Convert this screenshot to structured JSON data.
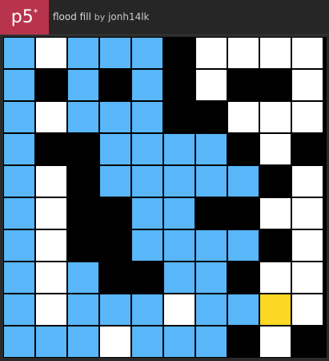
{
  "header": {
    "logo_text": "p5",
    "logo_mark": "*",
    "sketch_name": "flood fill",
    "by_label": "by",
    "author": "jonh14lk"
  },
  "palette": {
    "B": "#58b6f9",
    "W": "#ffffff",
    "K": "#000000",
    "Y": "#fcd723"
  },
  "board": {
    "rows": [
      [
        "B",
        "W",
        "B",
        "B",
        "B",
        "K",
        "W",
        "W",
        "W",
        "W"
      ],
      [
        "B",
        "K",
        "B",
        "K",
        "B",
        "K",
        "W",
        "K",
        "K",
        "W"
      ],
      [
        "B",
        "W",
        "B",
        "B",
        "B",
        "K",
        "K",
        "W",
        "W",
        "W"
      ],
      [
        "B",
        "K",
        "K",
        "B",
        "B",
        "B",
        "B",
        "K",
        "W",
        "K"
      ],
      [
        "B",
        "W",
        "K",
        "B",
        "B",
        "B",
        "B",
        "B",
        "K",
        "W"
      ],
      [
        "B",
        "W",
        "K",
        "K",
        "B",
        "B",
        "K",
        "K",
        "W",
        "W"
      ],
      [
        "B",
        "W",
        "K",
        "K",
        "B",
        "B",
        "B",
        "B",
        "K",
        "W"
      ],
      [
        "B",
        "W",
        "B",
        "K",
        "K",
        "B",
        "B",
        "K",
        "W",
        "W"
      ],
      [
        "B",
        "W",
        "B",
        "B",
        "B",
        "W",
        "B",
        "B",
        "Y",
        "W"
      ],
      [
        "B",
        "B",
        "B",
        "W",
        "B",
        "B",
        "B",
        "K",
        "W",
        "K"
      ]
    ]
  }
}
